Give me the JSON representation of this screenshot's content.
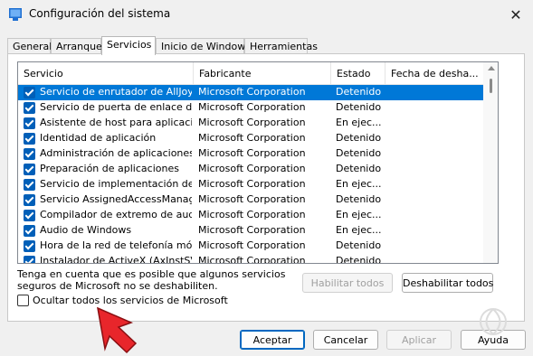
{
  "window": {
    "title": "Configuración del sistema"
  },
  "tabs": [
    "General",
    "Arranque",
    "Servicios",
    "Inicio de Windows",
    "Herramientas"
  ],
  "columns": [
    "Servicio",
    "Fabricante",
    "Estado",
    "Fecha de desha..."
  ],
  "rows": [
    {
      "service": "Servicio de enrutador de AllJoyn",
      "vendor": "Microsoft Corporation",
      "status": "Detenido",
      "date": "",
      "checked": true,
      "selected": true
    },
    {
      "service": "Servicio de puerta de enlace de ...",
      "vendor": "Microsoft Corporation",
      "status": "Detenido",
      "date": "",
      "checked": true,
      "selected": false
    },
    {
      "service": "Asistente de host para aplicacio...",
      "vendor": "Microsoft Corporation",
      "status": "En ejec...",
      "date": "",
      "checked": true,
      "selected": false
    },
    {
      "service": "Identidad de aplicación",
      "vendor": "Microsoft Corporation",
      "status": "Detenido",
      "date": "",
      "checked": true,
      "selected": false
    },
    {
      "service": "Administración de aplicaciones",
      "vendor": "Microsoft Corporation",
      "status": "Detenido",
      "date": "",
      "checked": true,
      "selected": false
    },
    {
      "service": "Preparación de aplicaciones",
      "vendor": "Microsoft Corporation",
      "status": "Detenido",
      "date": "",
      "checked": true,
      "selected": false
    },
    {
      "service": "Servicio de implementación de A...",
      "vendor": "Microsoft Corporation",
      "status": "En ejec...",
      "date": "",
      "checked": true,
      "selected": false
    },
    {
      "service": "Servicio AssignedAccessManager",
      "vendor": "Microsoft Corporation",
      "status": "Detenido",
      "date": "",
      "checked": true,
      "selected": false
    },
    {
      "service": "Compilador de extremo de audio...",
      "vendor": "Microsoft Corporation",
      "status": "En ejec...",
      "date": "",
      "checked": true,
      "selected": false
    },
    {
      "service": "Audio de Windows",
      "vendor": "Microsoft Corporation",
      "status": "En ejec...",
      "date": "",
      "checked": true,
      "selected": false
    },
    {
      "service": "Hora de la red de telefonía móvil",
      "vendor": "Microsoft Corporation",
      "status": "Detenido",
      "date": "",
      "checked": true,
      "selected": false
    },
    {
      "service": "Instalador de ActiveX (AxInstSV)",
      "vendor": "Microsoft Corporation",
      "status": "Detenido",
      "date": "",
      "checked": true,
      "selected": false
    }
  ],
  "note": "Tenga en cuenta que es posible que algunos servicios seguros de Microsoft no se deshabiliten.",
  "buttons": {
    "enable_all": "Habilitar todos",
    "disable_all": "Deshabilitar todos",
    "ok": "Aceptar",
    "cancel": "Cancelar",
    "apply": "Aplicar",
    "help": "Ayuda"
  },
  "hide_ms": {
    "label": "Ocultar todos los servicios de Microsoft",
    "checked": false
  },
  "colors": {
    "accent": "#005fb8",
    "selection": "#0078d7",
    "annotation_arrow": "#e8262b"
  }
}
